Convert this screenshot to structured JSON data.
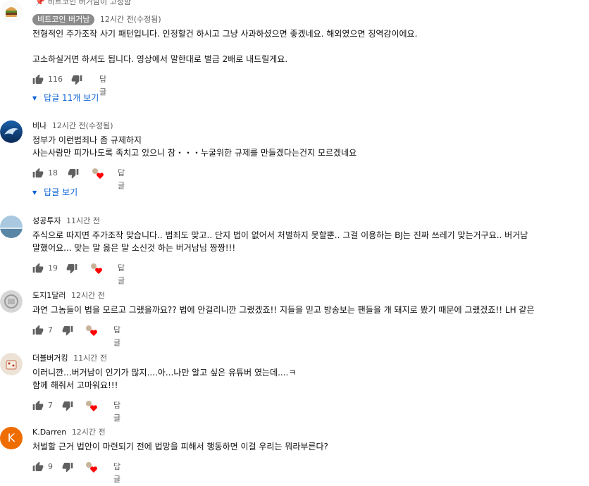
{
  "pinned_note": "비트코인 버거남이 고정함",
  "comments": [
    {
      "author": "비트코인 버거남",
      "author_is_creator": true,
      "time": "12시간 전(수정됨)",
      "lines": [
        "전형적인 주가조작 사기 패턴입니다. 인정할건 하시고 그냥 사과하셨으면 좋겠네요. 해외였으면 징역감이에요.",
        "",
        "고소하실거면 하셔도 됩니다. 영상에서 말한대로 벌금 2배로 내드릴게요."
      ],
      "likes": "116",
      "reply_label": "답글",
      "replies_toggle": "답글 11개 보기"
    },
    {
      "author": "비나",
      "time": "12시간 전(수정됨)",
      "lines": [
        "정부가 이런범죄나 좀 규제하지",
        "사는사람만 피가나도록 족치고 있으니  참・・・누굴위한 규제를 만들겠다는건지 모르겠네요"
      ],
      "likes": "18",
      "reply_label": "답글",
      "replies_toggle": "답글 보기"
    },
    {
      "author": "성공투자",
      "time": "11시간 전",
      "lines": [
        "주식으로 따지면 주가조작 맞습니다.. 범죄도 맞고.. 단지 법이 없어서 처벌하지 못할뿐.. 그걸 이용하는 BJ는 진짜 쓰레기 맞는거구요.. 버거남",
        "말했어요... 맞는 말 옳은 말 소신것 하는 버거남님 짱짱!!!"
      ],
      "likes": "19",
      "reply_label": "답글"
    },
    {
      "author": "도지1달러",
      "time": "12시간 전",
      "lines": [
        "과연 그놈들이 법을 모르고 그랬을까요?? 법에 안걸리니깐 그랬겠죠!! 지들을 믿고 방송보는 팬들을 개 돼지로 봤기 때문에 그랬겠죠!! LH 같은"
      ],
      "likes": "7",
      "reply_label": "답글"
    },
    {
      "author": "더블버거킹",
      "time": "11시간 전",
      "lines": [
        "이러니깐...버거남이 인기가 많지....아...나만 알고 싶은 유튜버 였는데....ㅋ",
        "함께 해줘서 고마워요!!!"
      ],
      "likes": "7",
      "reply_label": "답글"
    },
    {
      "author": "K.Darren",
      "avatar_letter": "K",
      "time": "12시간 전",
      "lines": [
        "처벌할 근거 법안이 마련되기 전에 법망을 피해서 행동하면 이걸 우리는 뭐라부른다?"
      ],
      "likes": "9",
      "reply_label": "답글"
    }
  ],
  "colors": {
    "link_blue": "#065fd4",
    "heart_red": "#ff0000",
    "creator_chip": "#8c8c8c",
    "avatar_orange": "#ef6c00"
  }
}
